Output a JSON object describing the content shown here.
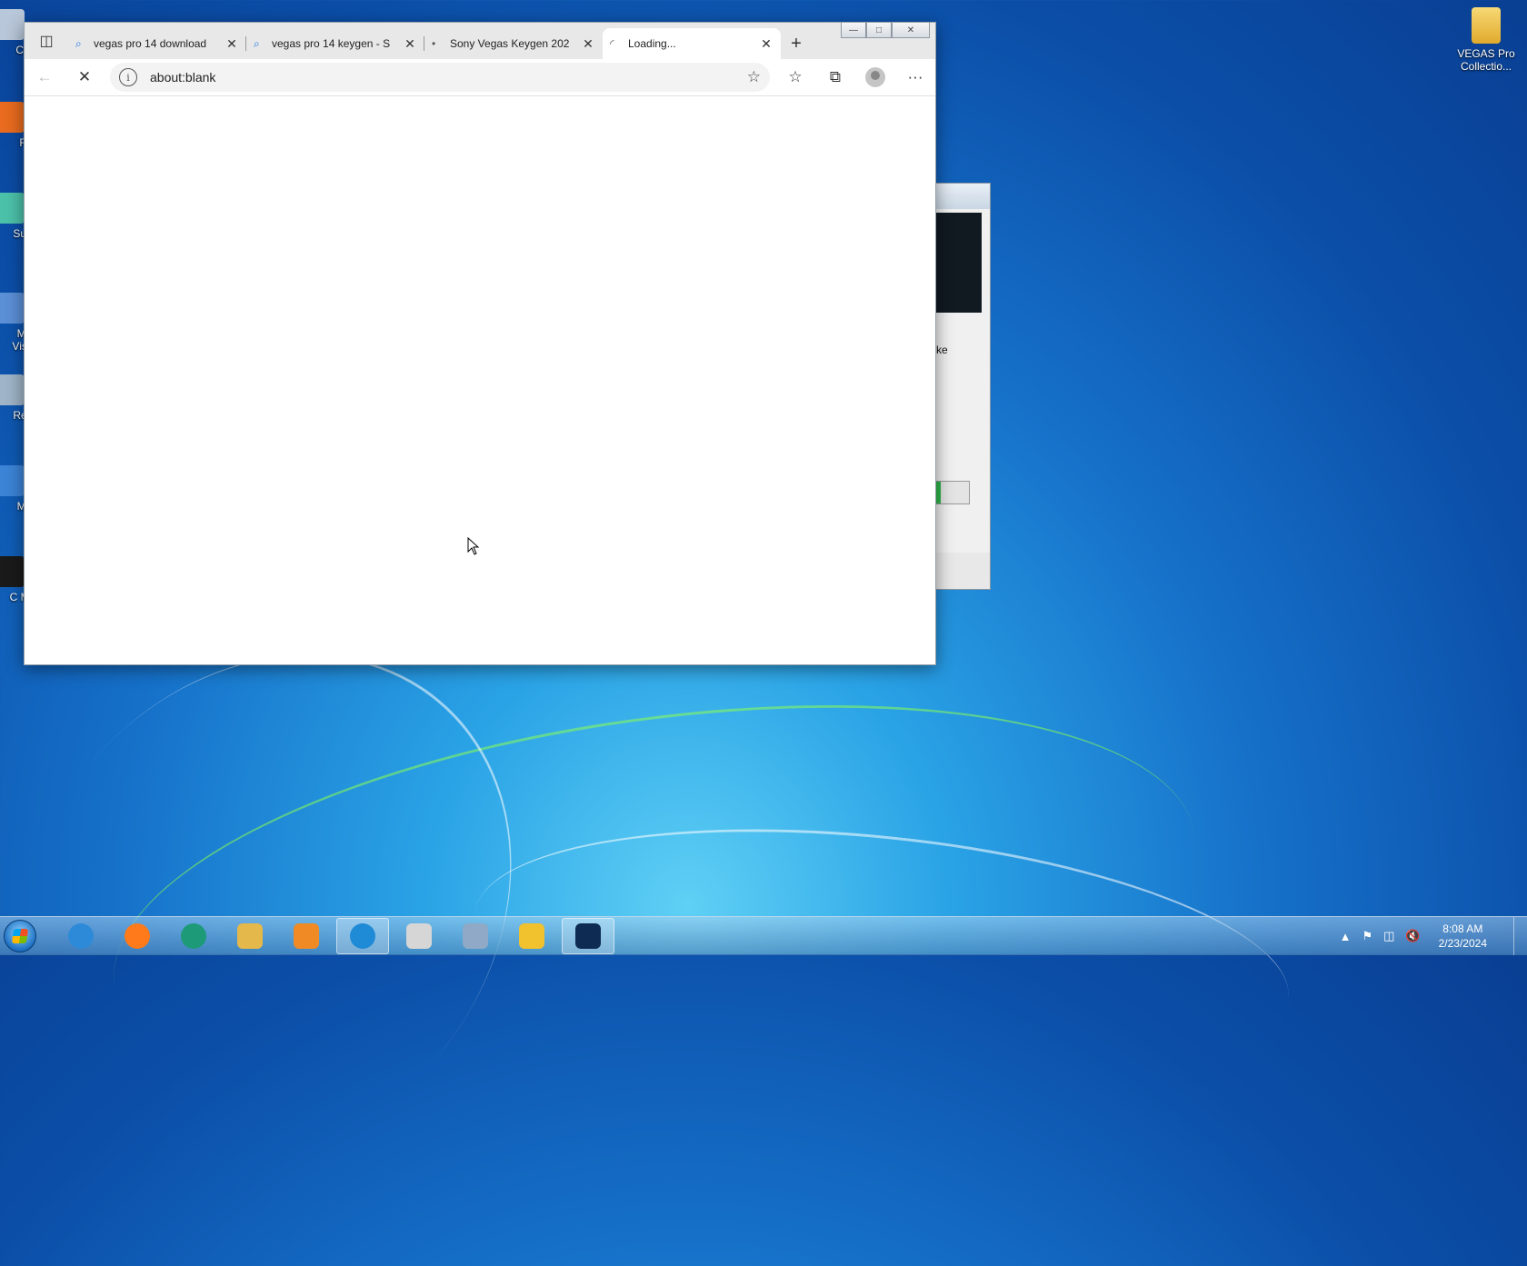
{
  "browser": {
    "tabs": [
      {
        "title": "vegas pro 14 download",
        "favicon": "search-icon",
        "active": false
      },
      {
        "title": "vegas pro 14 keygen - S",
        "favicon": "search-icon",
        "active": false
      },
      {
        "title": "Sony Vegas Keygen 202",
        "favicon": "page-icon",
        "active": false
      },
      {
        "title": "Loading...",
        "favicon": "loading-spinner-icon",
        "active": true
      }
    ],
    "address": "about:blank"
  },
  "desktop": {
    "icons": [
      {
        "label": "Co",
        "color": "#b8c7d9"
      },
      {
        "label": "F",
        "color": "#e86b1f"
      },
      {
        "label": "Sup",
        "color": "#4cc1a9"
      },
      {
        "label": "Mi Visu",
        "color": "#5b8fd6"
      },
      {
        "label": "Rec",
        "color": "#9fb4c8"
      },
      {
        "label": "Mi",
        "color": "#3b84d6"
      },
      {
        "label": "C Mu",
        "color": "#1a1a1a"
      }
    ],
    "folder_label": "VEGAS Pro Collectio..."
  },
  "dialog": {
    "partial_text": "ke"
  },
  "taskbar": {
    "apps": [
      {
        "name": "internet-explorer",
        "color": "#2d8ad9",
        "open": false
      },
      {
        "name": "firefox",
        "color": "#ff7a1a",
        "open": false
      },
      {
        "name": "green-app",
        "color": "#1d9a78",
        "open": false
      },
      {
        "name": "file-explorer",
        "color": "#e4b84a",
        "open": false
      },
      {
        "name": "media-player",
        "color": "#f08a24",
        "open": false
      },
      {
        "name": "edge",
        "color": "#1f8ad6",
        "open": true
      },
      {
        "name": "paint",
        "color": "#d6d6d6",
        "open": false
      },
      {
        "name": "calculator",
        "color": "#8fa9c6",
        "open": false
      },
      {
        "name": "security-shield",
        "color": "#f2c12e",
        "open": false
      },
      {
        "name": "vegas-installer",
        "color": "#0e2b54",
        "open": true
      }
    ],
    "time": "8:08 AM",
    "date": "2/23/2024"
  }
}
